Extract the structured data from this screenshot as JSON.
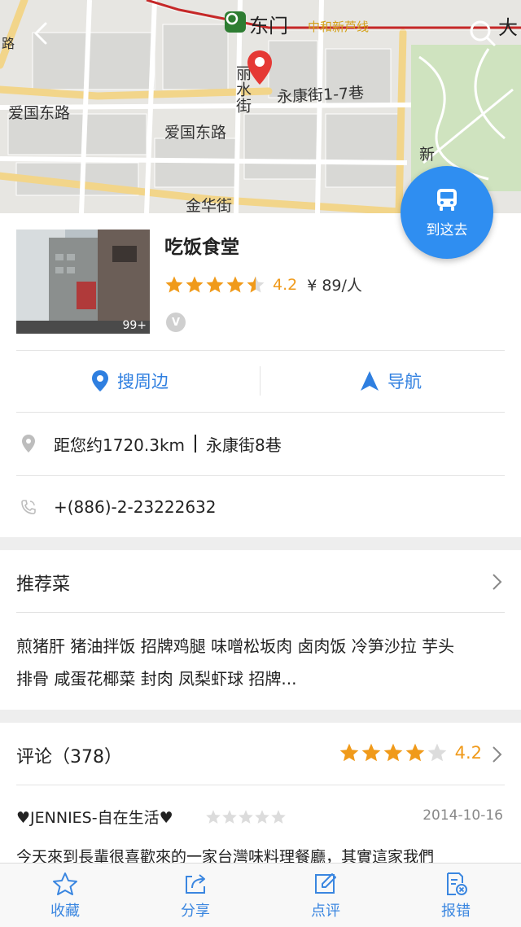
{
  "map": {
    "roads": [
      "爱国东路",
      "爱国东路",
      "丽水街",
      "永康街1-7巷",
      "金华街",
      "新",
      "路"
    ],
    "metro_station": "东门",
    "metro_line_label": "中和新芦线",
    "cut_label": "大"
  },
  "fab": {
    "label": "到这去",
    "icon": "bus-icon"
  },
  "poi": {
    "name": "吃饭食堂",
    "rating": "4.2",
    "rating_stars": 4.5,
    "price": "¥ 89/人",
    "photo_count": "99+",
    "verified_badge": "V"
  },
  "actions": {
    "search_nearby": "搜周边",
    "navigate": "导航"
  },
  "info": {
    "distance": "距您约1720.3km",
    "address": "永康街8巷",
    "phone": "+(886)-2-23222632"
  },
  "dishes": {
    "title": "推荐菜",
    "line1": "煎猪肝 猪油拌饭 招牌鸡腿 味噌松坂肉 卤肉饭 冷笋沙拉 芋头",
    "line2": "排骨 咸蛋花椰菜 封肉 凤梨虾球 招牌..."
  },
  "reviews": {
    "title": "评论（378）",
    "rating": "4.2",
    "rating_stars": 4,
    "first": {
      "user": "♥JENNIES-自在生活♥",
      "stars": 0,
      "date": "2014-10-16",
      "text": "今天來到長輩很喜歡來的一家台灣味料理餐廳，其實這家我們"
    }
  },
  "bottom_bar": {
    "favorite": "收藏",
    "share": "分享",
    "comment": "点评",
    "report": "报错"
  },
  "colors": {
    "accent_blue": "#2f8ef1",
    "star_orange": "#f09a1a",
    "pin_red": "#e53935",
    "metro_green": "#2e7d32",
    "metro_line": "#c62828"
  }
}
